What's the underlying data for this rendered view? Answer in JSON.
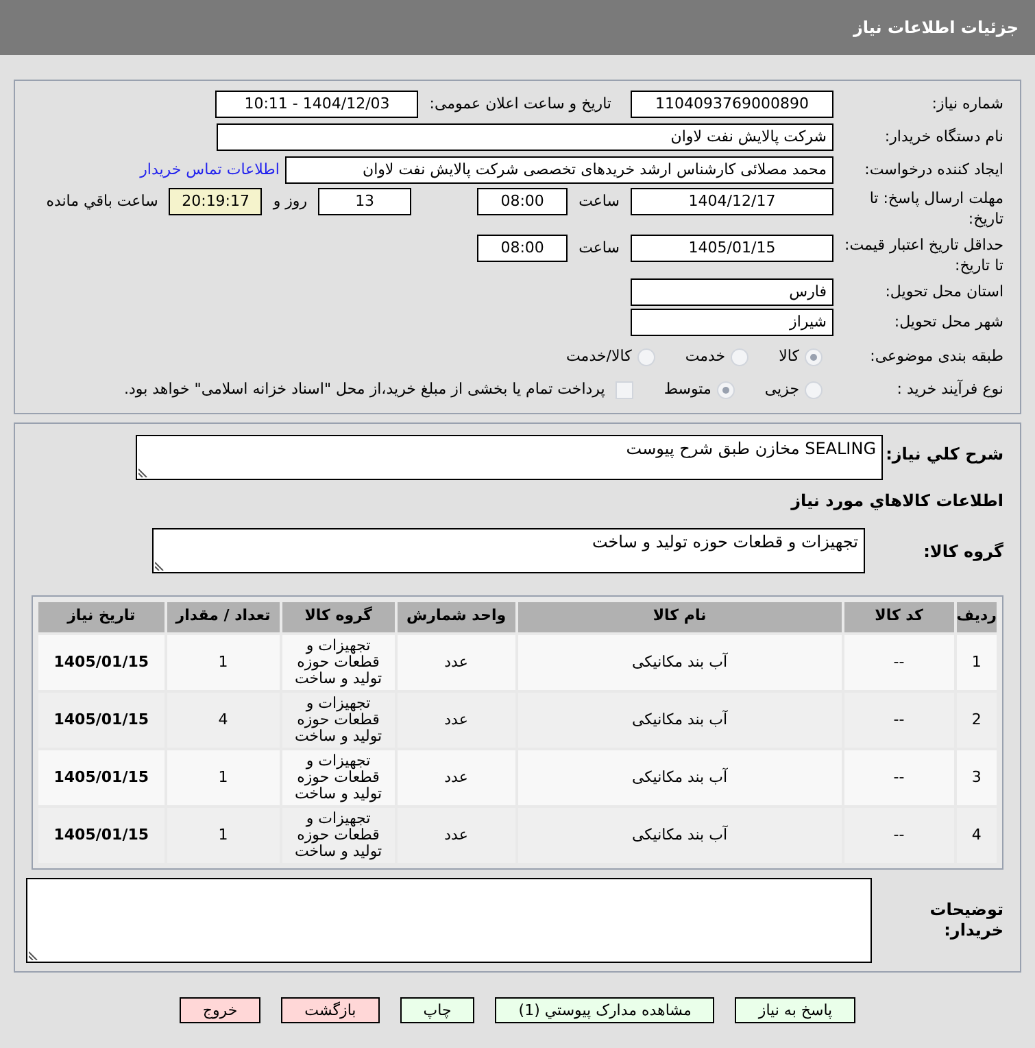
{
  "header": {
    "title": "جزئیات اطلاعات نیاز"
  },
  "need_number": {
    "label": "شماره نیاز:",
    "value": "1104093769000890"
  },
  "announce": {
    "label": "تاریخ و ساعت اعلان عمومی:",
    "value": "1404/12/03 - 10:11"
  },
  "buyer": {
    "label": "نام دستگاه خریدار:",
    "value": "شرکت پالایش نفت لاوان"
  },
  "creator": {
    "label": "ایجاد کننده درخواست:",
    "value": "محمد مصلائی کارشناس ارشد خریدهای تخصصی شرکت پالایش نفت لاوان",
    "link": "اطلاعات تماس خریدار"
  },
  "deadline": {
    "label": "مهلت ارسال پاسخ: تا تاریخ:",
    "date": "1404/12/17",
    "time_label": "ساعت",
    "time": "08:00",
    "days": "13",
    "days_label": "روز و",
    "remaining": "20:19:17",
    "remaining_label": "ساعت باقي مانده"
  },
  "validity": {
    "label": "حداقل تاریخ اعتبار قیمت: تا تاریخ:",
    "date": "1405/01/15",
    "time_label": "ساعت",
    "time": "08:00"
  },
  "province": {
    "label": "استان محل تحویل:",
    "value": "فارس"
  },
  "city": {
    "label": "شهر محل تحویل:",
    "value": "شیراز"
  },
  "category": {
    "label": "طبقه بندی موضوعی:",
    "options": [
      {
        "label": "کالا",
        "selected": true
      },
      {
        "label": "خدمت",
        "selected": false
      },
      {
        "label": "کالا/خدمت",
        "selected": false
      }
    ]
  },
  "process": {
    "label": "نوع فرآیند خرید :",
    "options": [
      {
        "label": "جزیی",
        "selected": false
      },
      {
        "label": "متوسط",
        "selected": true
      }
    ],
    "payment": {
      "checked": false,
      "text": "پرداخت تمام یا بخشی از مبلغ خرید،از محل \"اسناد خزانه اسلامی\" خواهد بود."
    }
  },
  "description": {
    "label": "شرح کلي نياز:",
    "value": "SEALING مخازن طبق شرح پیوست"
  },
  "goods_heading": "اطلاعات کالاهاي مورد نياز",
  "goods_group": {
    "label": "گروه کالا:",
    "value": "تجهیزات و قطعات حوزه تولید و ساخت"
  },
  "table": {
    "columns": [
      "رديف",
      "کد کالا",
      "نام کالا",
      "واحد شمارش",
      "گروه کالا",
      "تعداد / مقدار",
      "تاریخ نیاز"
    ],
    "rows": [
      [
        "1",
        "--",
        "آب بند مکانیکی",
        "عدد",
        "تجهیزات و قطعات حوزه تولید و ساخت",
        "1",
        "1405/01/15"
      ],
      [
        "2",
        "--",
        "آب بند مکانیکی",
        "عدد",
        "تجهیزات و قطعات حوزه تولید و ساخت",
        "4",
        "1405/01/15"
      ],
      [
        "3",
        "--",
        "آب بند مکانیکی",
        "عدد",
        "تجهیزات و قطعات حوزه تولید و ساخت",
        "1",
        "1405/01/15"
      ],
      [
        "4",
        "--",
        "آب بند مکانیکی",
        "عدد",
        "تجهیزات و قطعات حوزه تولید و ساخت",
        "1",
        "1405/01/15"
      ]
    ]
  },
  "buyer_notes": {
    "label": "توضیحات خریدار:"
  },
  "buttons": [
    {
      "label": "پاسخ به نیاز",
      "kind": "normal"
    },
    {
      "label": "مشاهده مدارک پیوستي (1)",
      "kind": "normal"
    },
    {
      "label": "چاپ",
      "kind": "normal"
    },
    {
      "label": "بازگشت",
      "kind": "danger"
    },
    {
      "label": "خروج",
      "kind": "danger"
    }
  ]
}
